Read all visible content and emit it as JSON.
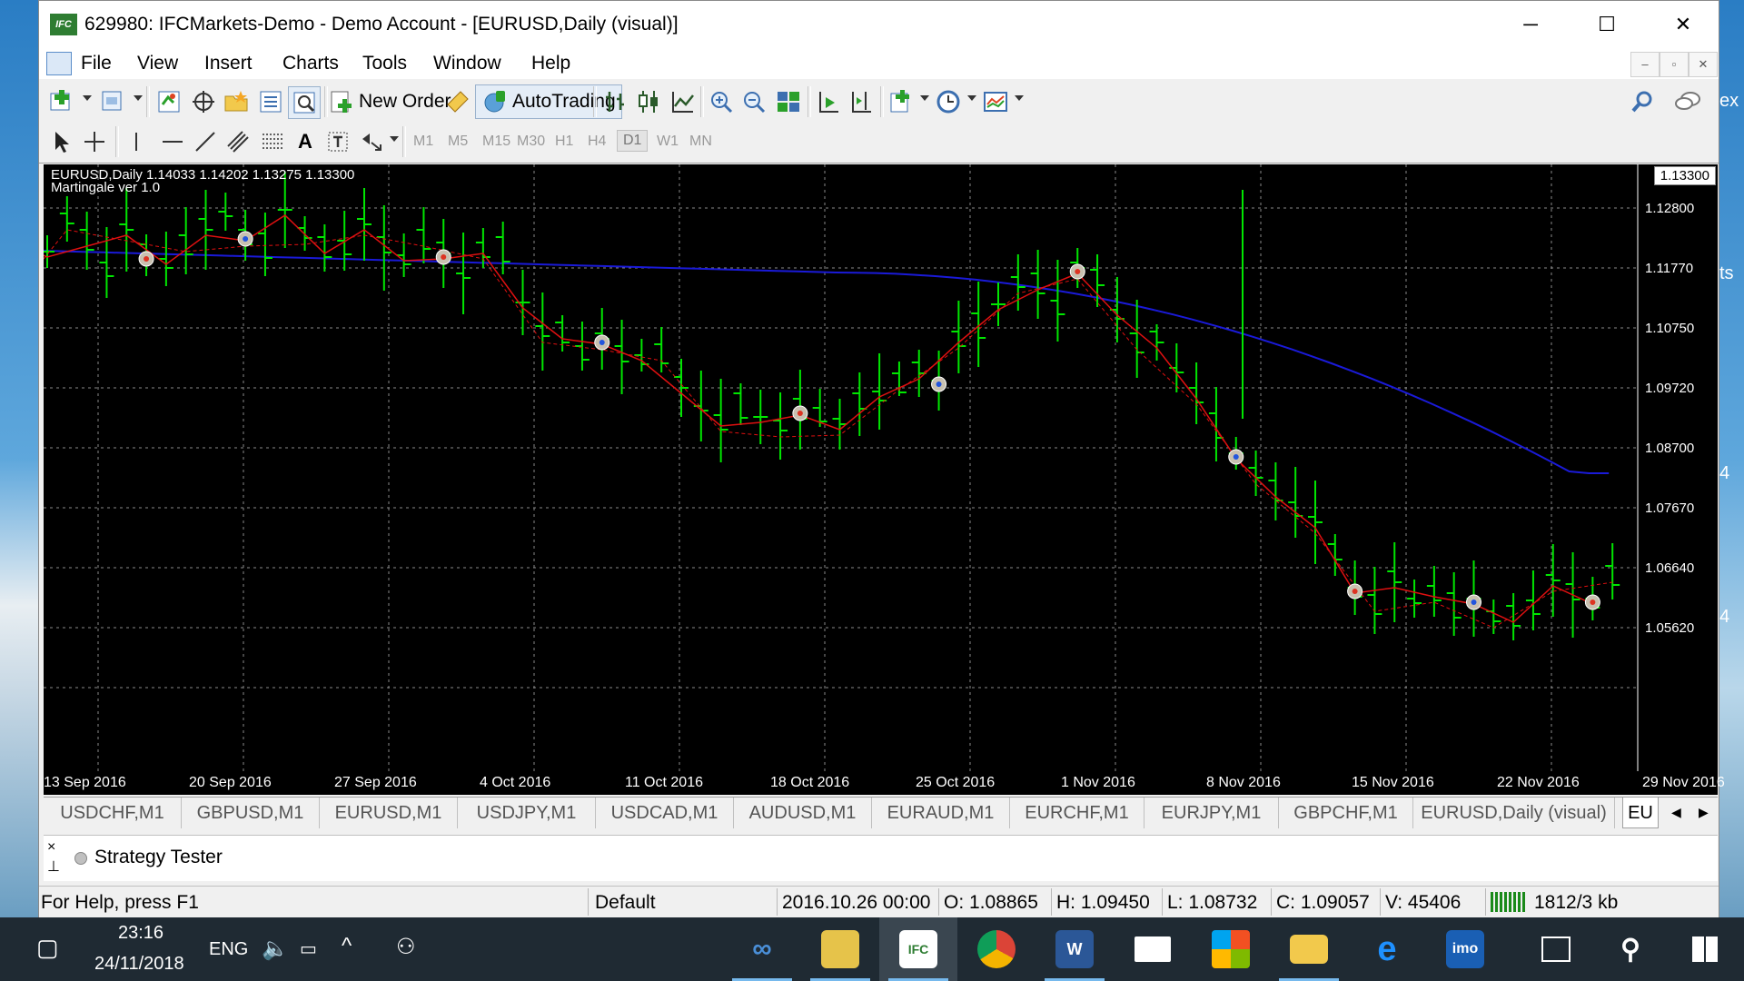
{
  "window": {
    "title": "629980: IFCMarkets-Demo - Demo Account - [EURUSD,Daily (visual)]",
    "logo_text": "IFC",
    "minimize": "─",
    "maximize": "☐",
    "close": "✕"
  },
  "menu": {
    "items": [
      "File",
      "View",
      "Insert",
      "Charts",
      "Tools",
      "Window",
      "Help"
    ],
    "mdi_minimize": "–",
    "mdi_restore": "▫",
    "mdi_close": "✕"
  },
  "toolbar": {
    "new_order": "New Order",
    "autotrading": "AutoTrading",
    "timeframes": [
      "M1",
      "M5",
      "M15",
      "M30",
      "H1",
      "H4",
      "D1",
      "W1",
      "MN"
    ],
    "active_timeframe": "D1"
  },
  "chart": {
    "header_line1": "EURUSD,Daily  1.14033 1.14202 1.13275 1.13300",
    "header_line2": "Martingale ver 1.0",
    "current_price": "1.13300",
    "price_labels": [
      "1.12800",
      "1.11770",
      "1.10750",
      "1.09720",
      "1.08700",
      "1.07670",
      "1.06640",
      "1.05620"
    ],
    "date_labels": [
      "13 Sep 2016",
      "20 Sep 2016",
      "27 Sep 2016",
      "4 Oct 2016",
      "11 Oct 2016",
      "18 Oct 2016",
      "25 Oct 2016",
      "1 Nov 2016",
      "8 Nov 2016",
      "15 Nov 2016",
      "22 Nov 2016",
      "29 Nov 2016"
    ],
    "colors": {
      "background": "#000000",
      "bar": "#00e600",
      "ma": "#1a1ad8",
      "trade_line": "#e01010",
      "grid": "#8a8a8a"
    }
  },
  "tabs": {
    "items": [
      "USDCHF,M1",
      "GBPUSD,M1",
      "EURUSD,M1",
      "USDJPY,M1",
      "USDCAD,M1",
      "AUDUSD,M1",
      "EURAUD,M1",
      "EURCHF,M1",
      "EURJPY,M1",
      "GBPCHF,M1",
      "EURUSD,Daily (visual)",
      "EU"
    ],
    "active": "EU",
    "left_arrow": "◀",
    "right_arrow": "▶"
  },
  "tester": {
    "label": "Strategy Tester",
    "close": "×",
    "pin": "⊥"
  },
  "status": {
    "help": "For Help, press F1",
    "profile": "Default",
    "datetime": "2016.10.26 00:00",
    "open": "O: 1.08865",
    "high": "H: 1.09450",
    "low": "L: 1.08732",
    "close": "C: 1.09057",
    "volume": "V: 45406",
    "traffic": "1812/3 kb"
  },
  "taskbar": {
    "time": "23:16",
    "date": "24/11/2018",
    "language": "ENG",
    "apps": [
      "chain-icon",
      "mt4-icon",
      "ifc-markets-icon",
      "chrome-icon",
      "word-icon",
      "mail-icon",
      "store-icon",
      "folder-icon",
      "edge-icon",
      "imo-icon",
      "task-view-icon",
      "search-icon",
      "windows-icon"
    ],
    "imo_label": "imo",
    "word_label": "W"
  },
  "desktop": {
    "edge_text": [
      "ex",
      "ts",
      "4",
      "4"
    ]
  }
}
